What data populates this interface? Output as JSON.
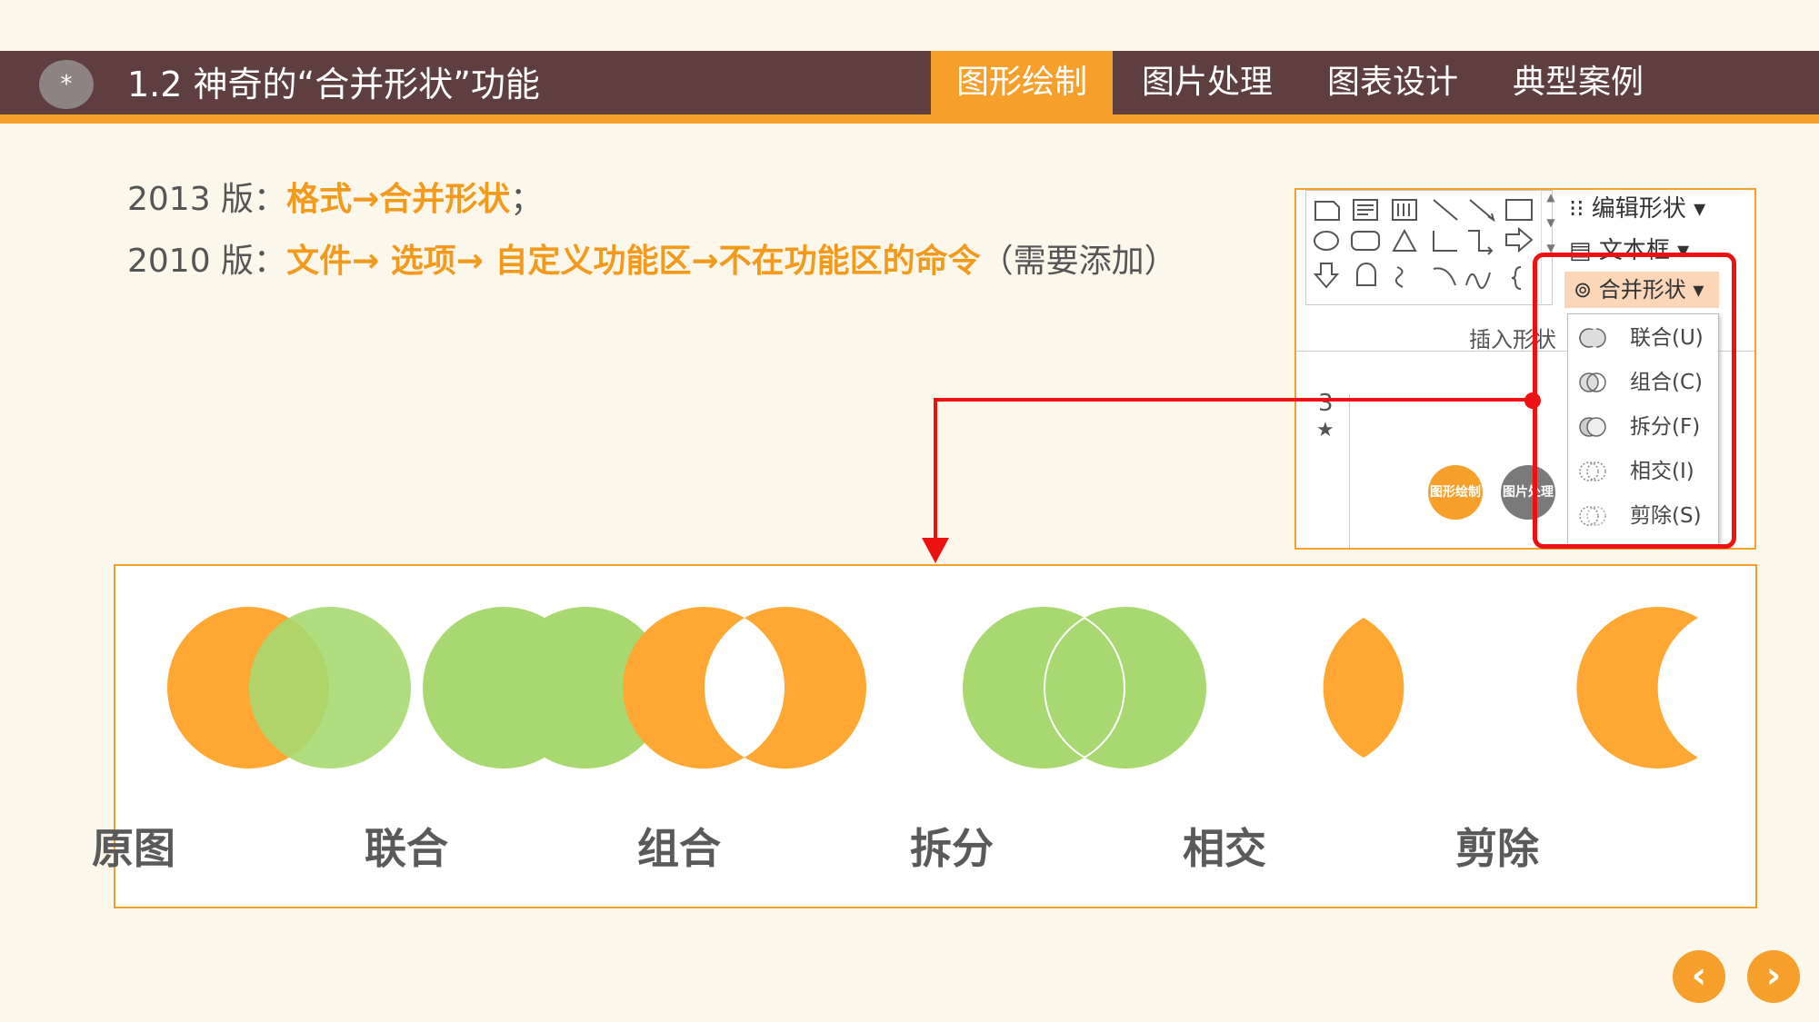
{
  "header": {
    "badge": "*",
    "title": "1.2  神奇的“合并形状”功能",
    "tabs": [
      {
        "label": "图形绘制",
        "active": true
      },
      {
        "label": "图片处理",
        "active": false
      },
      {
        "label": "图表设计",
        "active": false
      },
      {
        "label": "典型案例",
        "active": false
      }
    ]
  },
  "instructions": {
    "line1": {
      "prefix": "2013 版：",
      "highlight": "格式→合并形状",
      "suffix": "；"
    },
    "line2": {
      "prefix": "2010 版：",
      "highlight": "文件→ 选项→ 自定义功能区→不在功能区的命令",
      "suffix": "（需要添加）"
    }
  },
  "ribbon": {
    "edit_shape": "编辑形状",
    "text_box": "文本框",
    "merge_shapes": "合并形状",
    "insert_shapes": "插入形状",
    "slide_number": "3",
    "slide_star": "★",
    "mini_circles": [
      {
        "label": "图形绘制",
        "color": "#f6a02b"
      },
      {
        "label": "图片处理",
        "color": "#7a7a7a"
      }
    ],
    "menu": [
      {
        "label": "联合(U)",
        "icon": "union-icon"
      },
      {
        "label": "组合(C)",
        "icon": "combine-icon"
      },
      {
        "label": "拆分(F)",
        "icon": "fragment-icon"
      },
      {
        "label": "相交(I)",
        "icon": "intersect-icon"
      },
      {
        "label": "剪除(S)",
        "icon": "subtract-icon"
      }
    ]
  },
  "demo": {
    "labels": [
      "原图",
      "联合",
      "组合",
      "拆分",
      "相交",
      "剪除"
    ],
    "colors": {
      "orange": "#ffa733",
      "green": "#a7d970"
    }
  },
  "nav": {
    "prev": "‹",
    "next": "›"
  }
}
